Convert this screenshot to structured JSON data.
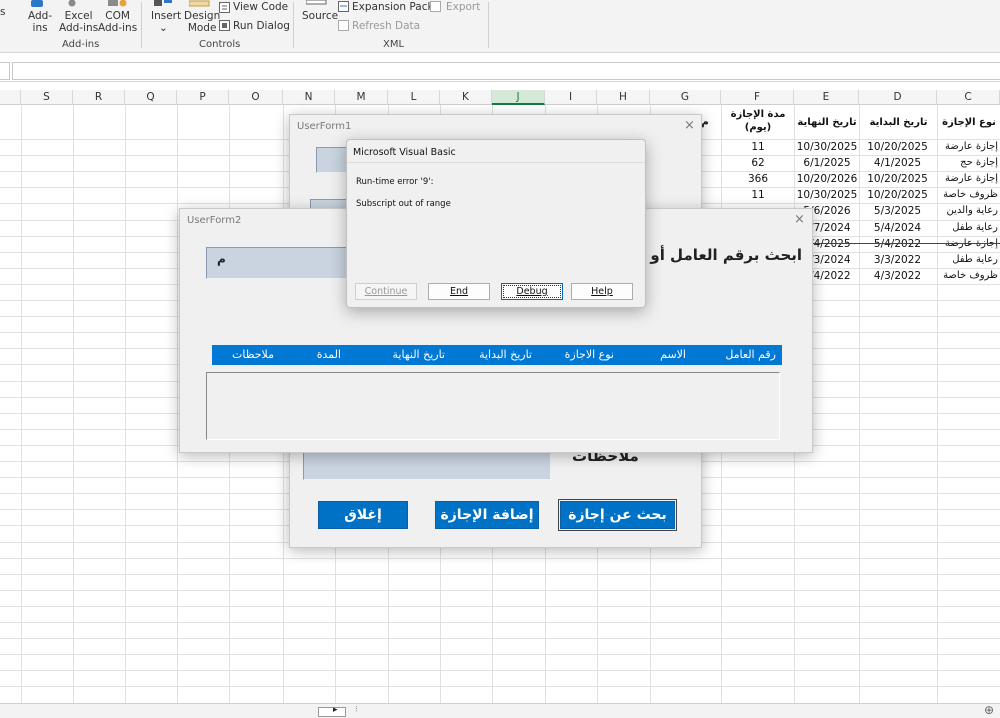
{
  "ribbon": {
    "s_label": "s",
    "addins_btn": "Add-\nins",
    "excel_addins_btn": "Excel\nAdd-ins",
    "com_addins_btn": "COM\nAdd-ins",
    "addins_group": "Add-ins",
    "insert_btn": "Insert",
    "design_mode_btn": "Design\nMode",
    "view_code_btn": "View Code",
    "run_dialog_btn": "Run Dialog",
    "controls_group": "Controls",
    "source_btn": "Source",
    "expansion_packs_btn": "Expansion Packs",
    "export_btn": "Export",
    "refresh_data_btn": "Refresh Data",
    "xml_group": "XML",
    "insert_dropdown": "⌄"
  },
  "columns": [
    "S",
    "R",
    "Q",
    "P",
    "O",
    "N",
    "M",
    "L",
    "K",
    "J",
    "I",
    "H",
    "G",
    "F",
    "E",
    "D",
    "C"
  ],
  "table": {
    "headers": {
      "c": "نوع الإجازة",
      "d": "تاريخ البداية",
      "e": "تاريخ النهاية",
      "f": "مدة الإجازة (يوم)",
      "g": "م"
    },
    "rows": [
      {
        "c": "إجازة عارضة",
        "d": "10/20/2025",
        "e": "10/30/2025",
        "f": "11"
      },
      {
        "c": "إجازة حج",
        "d": "4/1/2025",
        "e": "6/1/2025",
        "f": "62"
      },
      {
        "c": "إجازة عارضة",
        "d": "10/20/2025",
        "e": "10/20/2026",
        "f": "366"
      },
      {
        "c": "ظروف خاصة",
        "d": "10/20/2025",
        "e": "10/30/2025",
        "f": "11"
      },
      {
        "c": "رعاية والدين",
        "d": "5/3/2025",
        "e": "5/6/2026",
        "f": ""
      },
      {
        "c": "رعاية طفل",
        "d": "5/4/2024",
        "e": "6/7/2024",
        "f": ""
      },
      {
        "c": "إجازة عارضة",
        "d": "5/4/2022",
        "e": "3/4/2025",
        "f": ""
      },
      {
        "c": "رعاية طفل",
        "d": "3/3/2022",
        "e": "3/3/2024",
        "f": ""
      },
      {
        "c": "ظروف خاصة",
        "d": "4/3/2022",
        "e": "5/4/2022",
        "f": ""
      }
    ]
  },
  "userform1": {
    "title": "UserForm1",
    "close": "×",
    "notes_label": "ملاحظات",
    "search_btn": "بحث عن إجازة",
    "add_btn": "إضافة الإجازة",
    "close_btn": "إغلاق"
  },
  "userform2": {
    "title": "UserForm2",
    "close": "×",
    "search_label": "ابحث برقم العامل أو ا",
    "search_value": "م",
    "list_headers": [
      "رقم العامل",
      "الاسم",
      "نوع الاجازة",
      "تاريخ البداية",
      "تاريخ النهاية",
      "المدة",
      "ملاحظات"
    ]
  },
  "msgbox": {
    "title": "Microsoft Visual Basic",
    "error_line": "Run-time error '9':",
    "message": "Subscript out of range",
    "continue_btn": "Continue",
    "end_btn": "End",
    "debug_btn": "Debug",
    "help_btn": "Help"
  },
  "status": {
    "plus": "⊕",
    "dots": "⁝",
    "nav": "▸"
  },
  "colors": {
    "accent_blue": "#0072c6",
    "excel_green": "#107c41",
    "field_fill": "#c9d4e0"
  }
}
